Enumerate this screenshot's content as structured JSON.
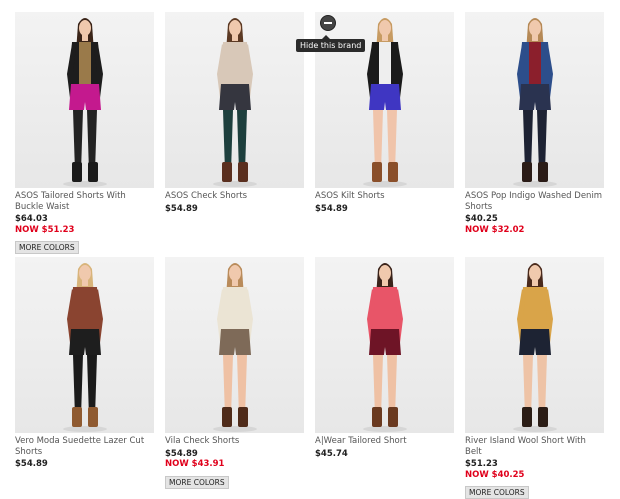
{
  "tooltip": {
    "label": "Hide this brand"
  },
  "products": [
    {
      "name": "ASOS Tailored Shorts With Buckle Waist",
      "price": "$64.03",
      "sale": "NOW $51.23",
      "button": "MORE COLORS",
      "colors": {
        "hair": "#3a2418",
        "top": "#9a7a4a",
        "jacket": "#1d1d1d",
        "bottom": "#c4198e",
        "legs": "#232323",
        "shoes": "#1b1b1b"
      }
    },
    {
      "name": "ASOS Check Shorts",
      "price": "$54.89",
      "sale": "",
      "button": "",
      "colors": {
        "hair": "#5c3a24",
        "top": "#d8c8b8",
        "jacket": "",
        "bottom": "#35363f",
        "legs": "#1d3f3d",
        "shoes": "#5a2f1f"
      }
    },
    {
      "name": "ASOS Kilt Shorts",
      "price": "$54.89",
      "sale": "",
      "button": "",
      "colors": {
        "hair": "#c79b62",
        "top": "#eeeeee",
        "jacket": "#1a1a1a",
        "bottom": "#3f36c2",
        "legs": "#f0c4aa",
        "shoes": "#8a4f2a"
      }
    },
    {
      "name": "ASOS Pop Indigo Washed Denim Shorts",
      "price": "$40.25",
      "sale": "NOW $32.02",
      "button": "",
      "colors": {
        "hair": "#b58956",
        "top": "#8b1f2c",
        "jacket": "#2d4e8b",
        "bottom": "#2a3350",
        "legs": "#1d2233",
        "shoes": "#2b1c17"
      }
    },
    {
      "name": "Vero Moda Suedette Lazer Cut Shorts",
      "price": "$54.89",
      "sale": "",
      "button": "",
      "colors": {
        "hair": "#d8b47a",
        "top": "#8a4430",
        "jacket": "",
        "bottom": "#1e1e1e",
        "legs": "#1b1b1b",
        "shoes": "#8f5a30"
      }
    },
    {
      "name": "Vila Check Shorts",
      "price": "$54.89",
      "sale": "NOW $43.91",
      "button": "MORE COLORS",
      "colors": {
        "hair": "#b98b5a",
        "top": "#ebe4d4",
        "jacket": "",
        "bottom": "#7e6a58",
        "legs": "#efc1a4",
        "shoes": "#4f2b1a"
      }
    },
    {
      "name": "A|Wear Tailored Short",
      "price": "$45.74",
      "sale": "",
      "button": "",
      "colors": {
        "hair": "#3a231a",
        "top": "#e85568",
        "jacket": "",
        "bottom": "#6e1426",
        "legs": "#efc1a4",
        "shoes": "#6a3a20"
      }
    },
    {
      "name": "River Island Wool Short With Belt",
      "price": "$51.23",
      "sale": "NOW $40.25",
      "button": "MORE COLORS",
      "colors": {
        "hair": "#4a2a1c",
        "top": "#d9a449",
        "jacket": "",
        "bottom": "#1d2333",
        "legs": "#eec3a6",
        "shoes": "#2b1d16"
      }
    }
  ]
}
